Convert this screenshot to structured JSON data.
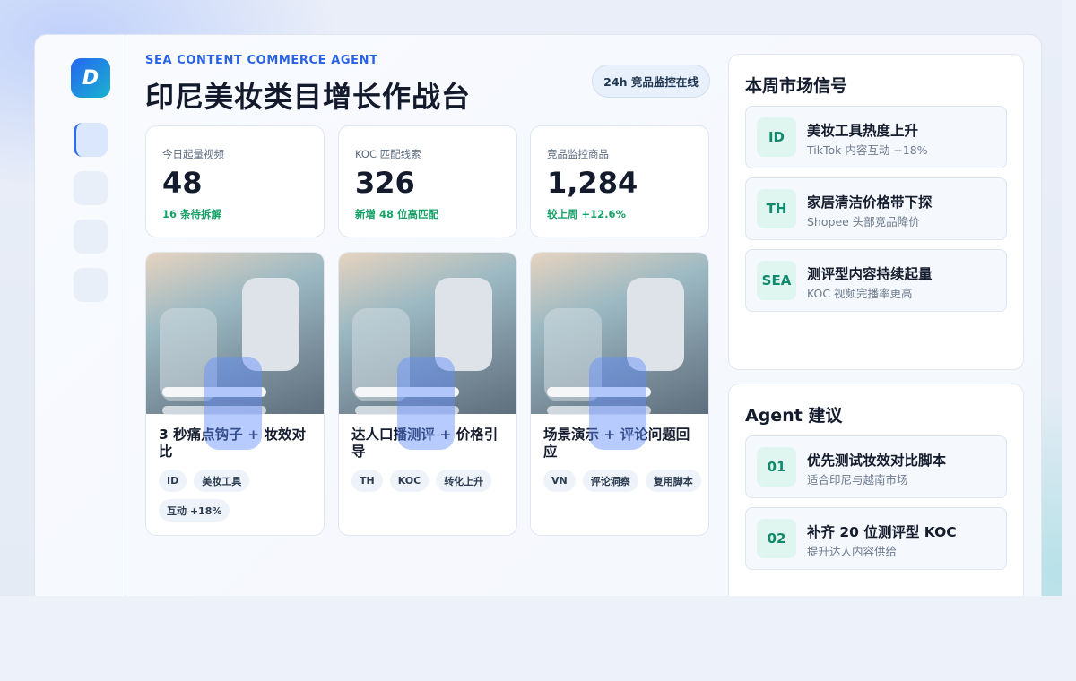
{
  "header": {
    "eyebrow": "SEA CONTENT COMMERCE AGENT",
    "title": "印尼美妆类目增长作战台",
    "status": "24h 竞品监控在线"
  },
  "logo": {
    "letter": "D",
    "colors": [
      "#2565f0",
      "#19b3cf"
    ]
  },
  "stats": [
    {
      "label": "今日起量视频",
      "value": "48",
      "sub": "16 条待拆解"
    },
    {
      "label": "KOC 匹配线索",
      "value": "326",
      "sub": "新增 48 位高匹配"
    },
    {
      "label": "竞品监控商品",
      "value": "1,284",
      "sub": "较上周 +12.6%"
    }
  ],
  "videos": [
    {
      "title": "3 秒痛点钩子 + 妆效对比",
      "tags": [
        "ID",
        "美妆工具",
        "互动 +18%"
      ]
    },
    {
      "title": "达人口播测评 + 价格引导",
      "tags": [
        "TH",
        "KOC",
        "转化上升"
      ]
    },
    {
      "title": "场景演示 + 评论问题回应",
      "tags": [
        "VN",
        "评论洞察",
        "复用脚本"
      ]
    }
  ],
  "signals": {
    "title": "本周市场信号",
    "items": [
      {
        "badge": "ID",
        "title": "美妆工具热度上升",
        "desc": "TikTok 内容互动 +18%"
      },
      {
        "badge": "TH",
        "title": "家居清洁价格带下探",
        "desc": "Shopee 头部竞品降价"
      },
      {
        "badge": "SEA",
        "title": "测评型内容持续起量",
        "desc": "KOC 视频完播率更高"
      }
    ]
  },
  "advice": {
    "title": "Agent 建议",
    "items": [
      {
        "badge": "01",
        "title": "优先测试妆效对比脚本",
        "desc": "适合印尼与越南市场"
      },
      {
        "badge": "02",
        "title": "补齐 20 位测评型 KOC",
        "desc": "提升达人内容供给"
      }
    ]
  },
  "colors": {
    "accent": "#2a62e6",
    "positive": "#17a168",
    "badge_bg": "#dff5ef",
    "badge_text": "#0f8a6d"
  }
}
